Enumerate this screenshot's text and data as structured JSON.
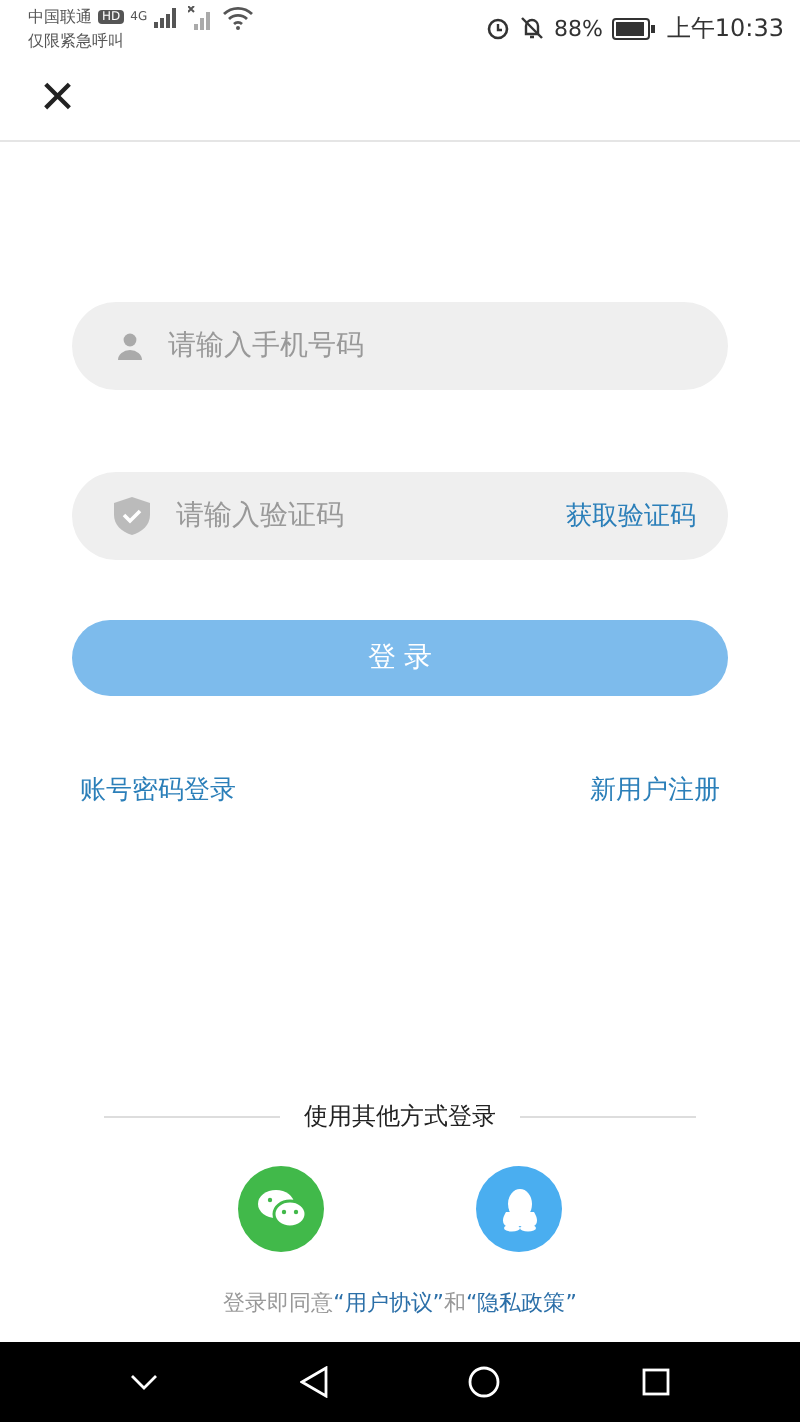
{
  "status_bar": {
    "carrier": "中国联通",
    "hd_badge": "HD",
    "emergency": "仅限紧急呼叫",
    "network": "4G",
    "battery": "88%",
    "time": "上午10:33"
  },
  "header": {
    "close_glyph": "×"
  },
  "form": {
    "phone": {
      "placeholder": "请输入手机号码"
    },
    "code": {
      "placeholder": "请输入验证码",
      "action": "获取验证码"
    },
    "login_button": {
      "label": "登 录",
      "disabled": true
    },
    "links": [
      "账号密码登录",
      "新用户注册"
    ]
  },
  "other_login": {
    "title": "使用其他方式登录",
    "providers": [
      {
        "kind": "wechat",
        "color": "#41b94a"
      },
      {
        "kind": "qq",
        "color": "#4aaef0"
      }
    ]
  },
  "agreement": [
    {
      "kind": "plain",
      "text": "登录即同意"
    },
    {
      "kind": "link",
      "text": "“用户协议”"
    },
    {
      "kind": "plain",
      "text": "和"
    },
    {
      "kind": "link",
      "text": "“隐私政策”"
    }
  ]
}
